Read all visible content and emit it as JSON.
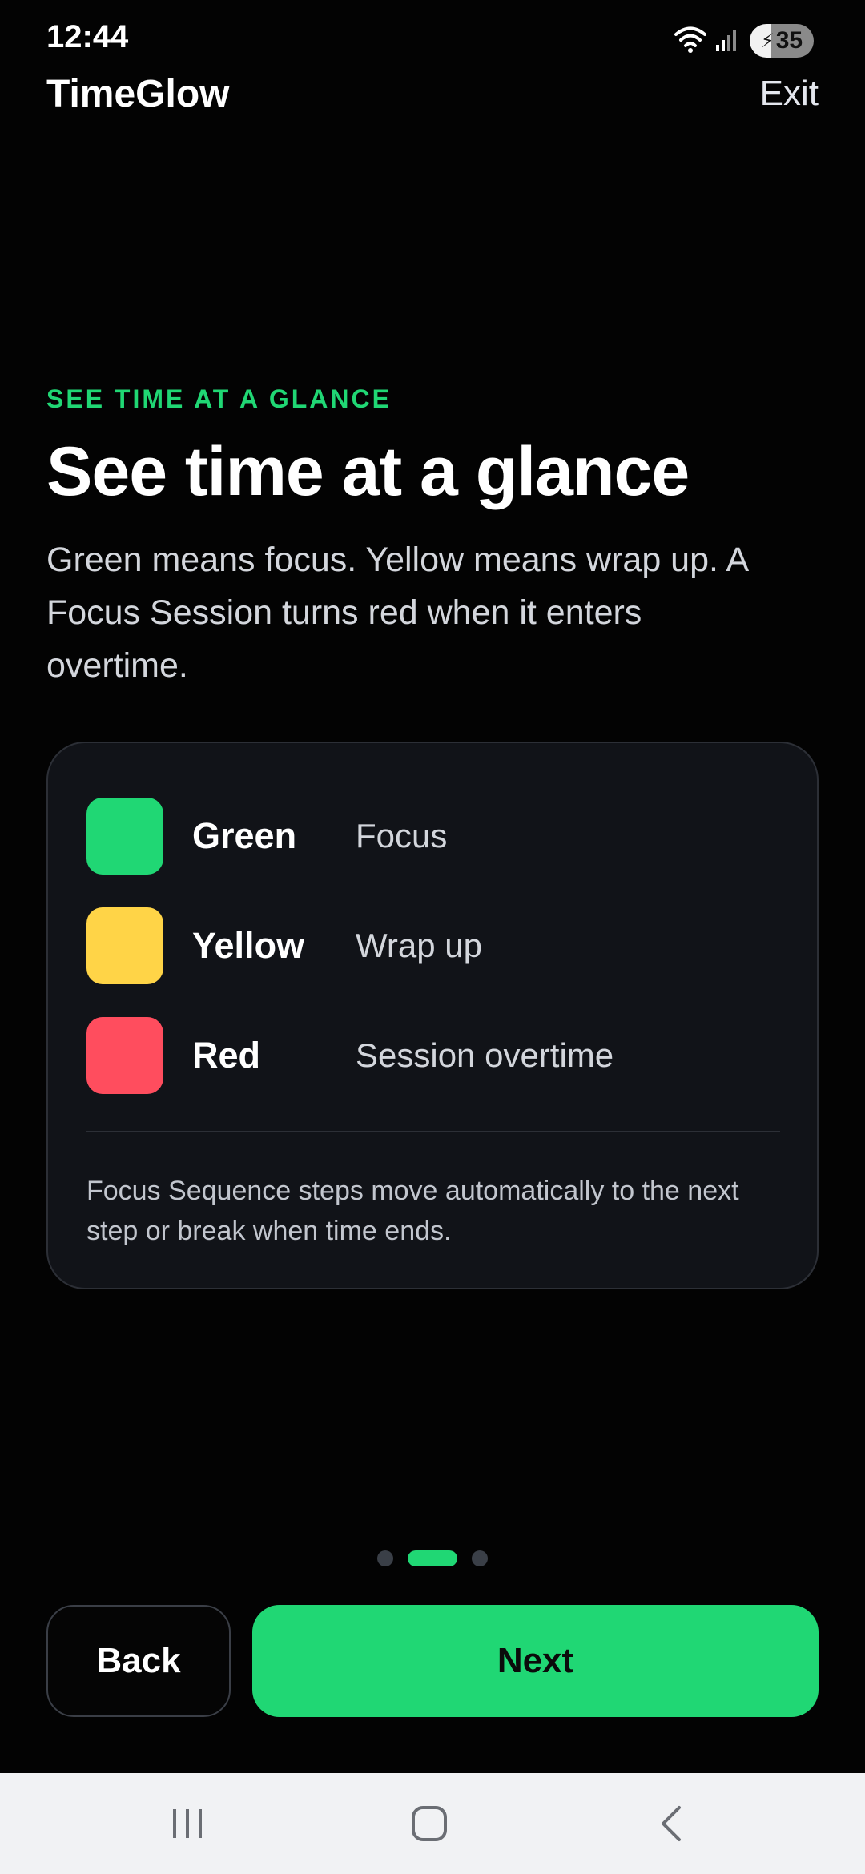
{
  "status_bar": {
    "time": "12:44",
    "battery_level": "35",
    "icons": [
      "wifi-icon",
      "signal-icon",
      "battery-charging-icon"
    ]
  },
  "header": {
    "app_title": "TimeGlow",
    "exit_label": "Exit"
  },
  "intro": {
    "eyebrow": "SEE TIME AT A GLANCE",
    "headline": "See time at a glance",
    "description": "Green means focus. Yellow means wrap up. A Focus Session turns red when it enters overtime."
  },
  "legend": {
    "items": [
      {
        "name": "Green",
        "meaning": "Focus",
        "color": "#20d774"
      },
      {
        "name": "Yellow",
        "meaning": "Wrap up",
        "color": "#ffd447"
      },
      {
        "name": "Red",
        "meaning": "Session overtime",
        "color": "#ff4d5e"
      }
    ],
    "footnote": "Focus Sequence steps move automatically to the next step or break when time ends."
  },
  "pager": {
    "total": 3,
    "current": 2,
    "active_color": "#20d774"
  },
  "actions": {
    "back_label": "Back",
    "next_label": "Next"
  },
  "system_nav": {
    "icons": [
      "recents-icon",
      "home-icon",
      "back-icon"
    ]
  }
}
